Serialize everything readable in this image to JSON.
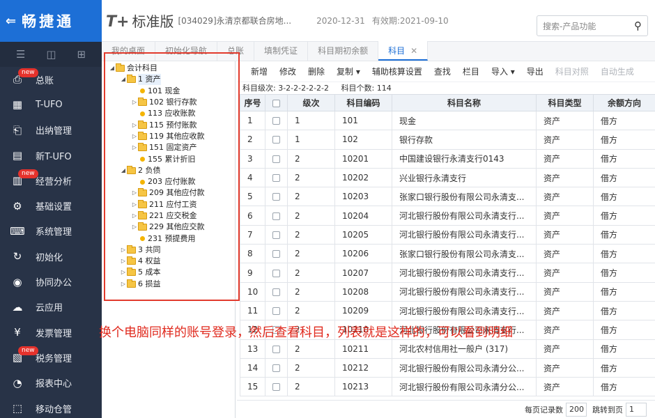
{
  "brand": {
    "logo_text": "畅捷通",
    "back_icon": "back-arrow-icon"
  },
  "header": {
    "product_name": "T+",
    "edition": "标准版",
    "company": "[034029]永清京都联合房地...",
    "date": "2020-12-31",
    "validity": "有效期:2021-09-10",
    "search_placeholder": "搜索-产品功能"
  },
  "sidebar": {
    "tools": [
      "menu-icon",
      "screen-icon",
      "add-icon"
    ],
    "items": [
      {
        "label": "总账",
        "icon": "ledger-icon",
        "badge": "new"
      },
      {
        "label": "T-UFO",
        "icon": "ufo-icon",
        "badge": ""
      },
      {
        "label": "出纳管理",
        "icon": "cashier-icon",
        "badge": ""
      },
      {
        "label": "新T-UFO",
        "icon": "grid-icon",
        "badge": ""
      },
      {
        "label": "经营分析",
        "icon": "chart-icon",
        "badge": "new"
      },
      {
        "label": "基础设置",
        "icon": "settings-icon",
        "badge": ""
      },
      {
        "label": "系统管理",
        "icon": "system-icon",
        "badge": ""
      },
      {
        "label": "初始化",
        "icon": "init-icon",
        "badge": ""
      },
      {
        "label": "协同办公",
        "icon": "collab-icon",
        "badge": ""
      },
      {
        "label": "云应用",
        "icon": "cloud-icon",
        "badge": ""
      },
      {
        "label": "发票管理",
        "icon": "invoice-icon",
        "badge": ""
      },
      {
        "label": "税务管理",
        "icon": "tax-icon",
        "badge": "new"
      },
      {
        "label": "报表中心",
        "icon": "report-icon",
        "badge": ""
      },
      {
        "label": "移动仓管",
        "icon": "mobile-icon",
        "badge": ""
      }
    ]
  },
  "tabs": [
    {
      "label": "我的桌面",
      "active": false
    },
    {
      "label": "初始化导航",
      "active": false
    },
    {
      "label": "总账",
      "active": false
    },
    {
      "label": "填制凭证",
      "active": false
    },
    {
      "label": "科目期初余额",
      "active": false
    },
    {
      "label": "科目",
      "active": true
    }
  ],
  "tree": [
    {
      "label": "会计科目",
      "level": 0,
      "type": "folder",
      "toggle": "▲"
    },
    {
      "label": "1 资产",
      "level": 1,
      "type": "folder",
      "toggle": "▲",
      "selected": true
    },
    {
      "label": "101 现金",
      "level": 2,
      "type": "leaf",
      "toggle": ""
    },
    {
      "label": "102 银行存款",
      "level": 2,
      "type": "folder",
      "toggle": "▷"
    },
    {
      "label": "113 应收账款",
      "level": 2,
      "type": "leaf",
      "toggle": ""
    },
    {
      "label": "115 预付账款",
      "level": 2,
      "type": "folder",
      "toggle": "▷"
    },
    {
      "label": "119 其他应收款",
      "level": 2,
      "type": "folder",
      "toggle": "▷"
    },
    {
      "label": "151 固定资产",
      "level": 2,
      "type": "folder",
      "toggle": "▷"
    },
    {
      "label": "155 累计折旧",
      "level": 2,
      "type": "leaf",
      "toggle": ""
    },
    {
      "label": "2 负债",
      "level": 1,
      "type": "folder",
      "toggle": "▲"
    },
    {
      "label": "203 应付账款",
      "level": 2,
      "type": "leaf",
      "toggle": ""
    },
    {
      "label": "209 其他应付款",
      "level": 2,
      "type": "folder",
      "toggle": "▷"
    },
    {
      "label": "211 应付工资",
      "level": 2,
      "type": "folder",
      "toggle": "▷"
    },
    {
      "label": "221 应交税金",
      "level": 2,
      "type": "folder",
      "toggle": "▷"
    },
    {
      "label": "229 其他应交款",
      "level": 2,
      "type": "folder",
      "toggle": "▷"
    },
    {
      "label": "231 预提费用",
      "level": 2,
      "type": "leaf",
      "toggle": ""
    },
    {
      "label": "3 共同",
      "level": 1,
      "type": "folder",
      "toggle": "▷"
    },
    {
      "label": "4 权益",
      "level": 1,
      "type": "folder",
      "toggle": "▷"
    },
    {
      "label": "5 成本",
      "level": 1,
      "type": "folder",
      "toggle": "▷"
    },
    {
      "label": "6 损益",
      "level": 1,
      "type": "folder",
      "toggle": "▷"
    }
  ],
  "toolbar": [
    {
      "label": "新增",
      "disabled": false
    },
    {
      "label": "修改",
      "disabled": false
    },
    {
      "label": "删除",
      "disabled": false
    },
    {
      "label": "复制 ▾",
      "disabled": false
    },
    {
      "label": "辅助核算设置",
      "disabled": false
    },
    {
      "label": "查找",
      "disabled": false
    },
    {
      "label": "栏目",
      "disabled": false
    },
    {
      "label": "导入 ▾",
      "disabled": false
    },
    {
      "label": "导出",
      "disabled": false
    },
    {
      "label": "科目对照",
      "disabled": true
    },
    {
      "label": "自动生成",
      "disabled": true
    }
  ],
  "info": {
    "levels": "科目级次: 3-2-2-2-2-2-2",
    "count": "科目个数: 114"
  },
  "grid": {
    "headers": [
      "序号",
      "",
      "级次",
      "科目编码",
      "科目名称",
      "科目类型",
      "余额方向"
    ],
    "rows": [
      [
        "1",
        "1",
        "101",
        "现金",
        "资产",
        "借方"
      ],
      [
        "2",
        "1",
        "102",
        "银行存款",
        "资产",
        "借方"
      ],
      [
        "3",
        "2",
        "10201",
        "中国建设银行永清支行0143",
        "资产",
        "借方"
      ],
      [
        "4",
        "2",
        "10202",
        "兴业银行永清支行",
        "资产",
        "借方"
      ],
      [
        "5",
        "2",
        "10203",
        "张家口银行股份有限公司永清支...",
        "资产",
        "借方"
      ],
      [
        "6",
        "2",
        "10204",
        "河北银行股份有限公司永清支行...",
        "资产",
        "借方"
      ],
      [
        "7",
        "2",
        "10205",
        "河北银行股份有限公司永清支行...",
        "资产",
        "借方"
      ],
      [
        "8",
        "2",
        "10206",
        "张家口银行股份有限公司永清支...",
        "资产",
        "借方"
      ],
      [
        "9",
        "2",
        "10207",
        "河北银行股份有限公司永清支行...",
        "资产",
        "借方"
      ],
      [
        "10",
        "2",
        "10208",
        "河北银行股份有限公司永清支行...",
        "资产",
        "借方"
      ],
      [
        "11",
        "2",
        "10209",
        "河北银行股份有限公司永清支行...",
        "资产",
        "借方"
      ],
      [
        "12",
        "2",
        "10210",
        "河北银行股份有限公司永清支行...",
        "资产",
        "借方"
      ],
      [
        "13",
        "2",
        "10211",
        "河北农村信用社一般户 (317)",
        "资产",
        "借方"
      ],
      [
        "14",
        "2",
        "10212",
        "河北银行股份有限公司永清分公...",
        "资产",
        "借方"
      ],
      [
        "15",
        "2",
        "10213",
        "河北银行股份有限公司永清分公...",
        "资产",
        "借方"
      ]
    ]
  },
  "footer": {
    "per_page_label": "每页记录数",
    "per_page": "200",
    "jump_label": "跳转到页",
    "page": "1"
  },
  "annotation": "换个电脑同样的账号登录，然后查看科目，列表就是这样的，可以看到明细",
  "colors": {
    "sidebar_bg": "#283347",
    "brand_blue": "#1d6fd6",
    "annotation_red": "#e02a1e"
  }
}
